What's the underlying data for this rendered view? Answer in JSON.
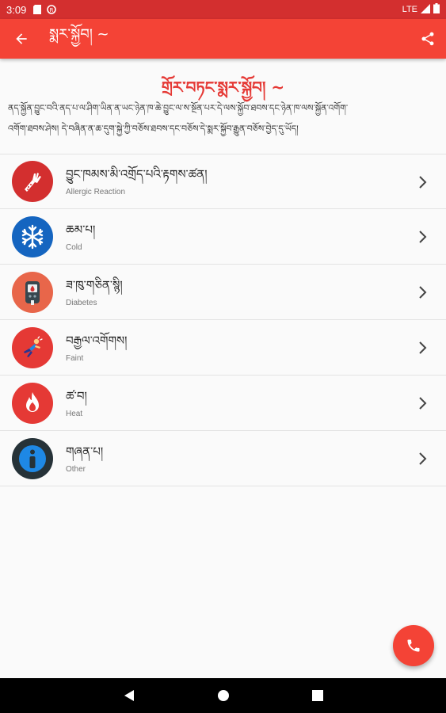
{
  "colors": {
    "status_bar": "#d32f2f",
    "app_bar": "#f44336",
    "accent": "#e53935",
    "background": "#fafafa"
  },
  "status_bar": {
    "time": "3:09",
    "network": "LTE"
  },
  "app_bar": {
    "title": "སྨར་སྐྱོབ། ~",
    "back_icon": "arrow-back-icon",
    "share_icon": "share-icon"
  },
  "main": {
    "heading": "གྲོར་བཏང་སྨར་སྐྱོབ། ~",
    "description_line1": "ནད་སྐྱོན་བྱུང་བའི་ནད་པ་ལ་ཤིག་ཡིན་ན་ཡང་ཉེན་ཁ་ཆེ་བྱུང་ལ་ས་སྔོན་པར་དེ་ལས་སྐྱོབ་ཐབས་དང་ཉེན་ཁ་ལས་སྐྱོན་འགོག་",
    "description_line2": "འགོག་ཐབས་ཤེས། དེ་བཞིན་ན་ཆ་དུག་སྐྱེ་ཀྱི་བཅོས་ཐབས་དང་བཅོས་དེ་སྨར་སྐྱོབ་རྒྱུན་བཅོས་བྱེད་དུ་ཡོད།"
  },
  "list": {
    "items": [
      {
        "tibetan": "བྱུང་ཁམས་མི་འགྲོད་པའི་རྟགས་ཚན།",
        "english": "Allergic Reaction",
        "icon": "allergic-arm-icon",
        "color": "#d32f2f"
      },
      {
        "tibetan": "ཆམ་པ།",
        "english": "Cold",
        "icon": "snowflake-icon",
        "color": "#1565c0"
      },
      {
        "tibetan": "ཟ་ཁུ་གཅིན་སྙི།",
        "english": "Diabetes",
        "icon": "glucometer-icon",
        "color": "#e8664a"
      },
      {
        "tibetan": "བརྒྱལ་འགོགས།",
        "english": "Faint",
        "icon": "fainting-person-icon",
        "color": "#e53935"
      },
      {
        "tibetan": "ཚ་བ།",
        "english": "Heat",
        "icon": "flame-icon",
        "color": "#e53935"
      },
      {
        "tibetan": "གཞན་པ།",
        "english": "Other",
        "icon": "info-icon",
        "color": "#263238"
      }
    ]
  },
  "fab": {
    "icon": "phone-icon"
  },
  "nav_bar": {
    "back": "nav-back-icon",
    "home": "nav-home-icon",
    "recents": "nav-recents-icon"
  }
}
